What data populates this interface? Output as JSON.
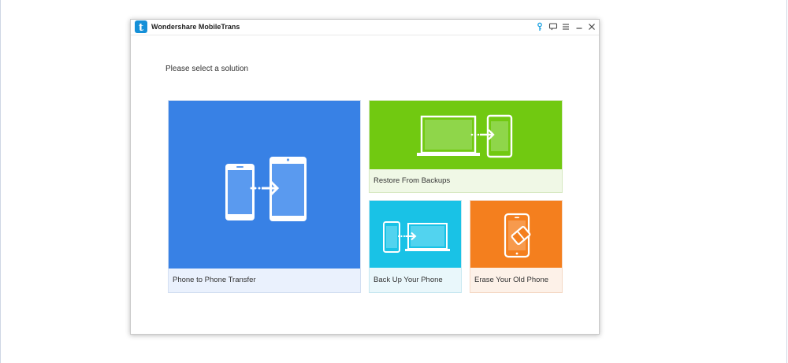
{
  "window": {
    "title": "Wondershare MobileTrans",
    "logo_letter": "t"
  },
  "titlebar_buttons": {
    "key": "key-icon",
    "feedback": "chat-icon",
    "menu": "menu-icon",
    "minimize": "minimize-icon",
    "close": "close-icon"
  },
  "main": {
    "heading": "Please select a solution",
    "tiles": [
      {
        "label": "Phone to Phone Transfer",
        "color": "#3881e5",
        "icon": "phone-to-phone-icon"
      },
      {
        "label": "Restore From Backups",
        "color": "#71c911",
        "icon": "laptop-to-phone-icon"
      },
      {
        "label": "Back Up Your Phone",
        "color": "#19c2e6",
        "icon": "phone-to-laptop-icon"
      },
      {
        "label": "Erase Your Old Phone",
        "color": "#f47f1e",
        "icon": "phone-eraser-icon"
      }
    ]
  },
  "colors": {
    "accent_blue": "#1aa0e0"
  }
}
